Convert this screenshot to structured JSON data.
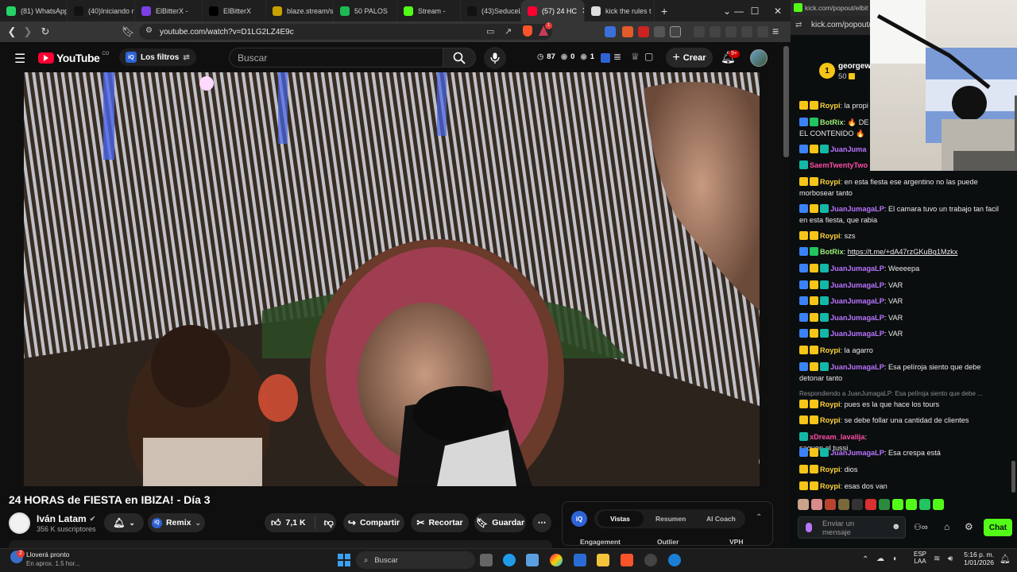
{
  "browser": {
    "tabs": [
      {
        "label": "(81) WhatsApp",
        "color": "#25d366"
      },
      {
        "label": "(40)Iniciando r",
        "color": "#111111"
      },
      {
        "label": "ElBitterX -",
        "color": "#7b3fe4"
      },
      {
        "label": "ElBitterX",
        "color": "#000000"
      },
      {
        "label": "blaze.stream/s",
        "color": "#c8a000"
      },
      {
        "label": "50 PALOS",
        "color": "#1db954"
      },
      {
        "label": "Stream -",
        "color": "#53fc18"
      },
      {
        "label": "(43)SeduceLaV",
        "color": "#111111"
      },
      {
        "label": "(57) 24 HC",
        "color": "#ff0033",
        "active": true
      },
      {
        "label": "kick the rules t",
        "color": "#dddddd"
      }
    ],
    "new_tab": "+",
    "url": "youtube.com/watch?v=D1LG2LZ4E9c",
    "shield_count": "1"
  },
  "youtube": {
    "logo_text": "YouTube",
    "logo_country": "CO",
    "filters_label": "Los filtros",
    "search_placeholder": "Buscar",
    "stats": {
      "a": "87",
      "b": "0",
      "c": "1"
    },
    "create_label": "Crear",
    "notif_count": "9+"
  },
  "video": {
    "title": "24 HORAS de FIESTA en IBIZA! - Día 3",
    "channel": "Iván Latam",
    "subscribers": "356 K suscriptores",
    "remix_label": "Remix",
    "like_count": "7,1 K",
    "share_label": "Compartir",
    "clip_label": "Recortar",
    "save_label": "Guardar",
    "more_label": "⋯"
  },
  "iq_panel": {
    "tabs": [
      "Vistas",
      "Resumen",
      "AI Coach"
    ],
    "columns": [
      "Engagement",
      "Outlier",
      "VPH"
    ]
  },
  "kick": {
    "url": "kick.com/popout/elbitt",
    "url_short": "kick.com/popout/",
    "gift_user": "georgew",
    "gift_rank": "1",
    "gift_amount": "50",
    "messages": [
      {
        "user": "Roypi",
        "text": ": la propi",
        "kind": "roy"
      },
      {
        "user": "BotRix",
        "text": ": 🔥 DE",
        "cont": "EL CONTENIDO 🔥",
        "kind": "bot"
      },
      {
        "user": "JuanJuma",
        "text": "",
        "kind": "juan"
      },
      {
        "user": "SaemTwentyTwo",
        "text": "",
        "kind": "red"
      },
      {
        "user": "Roypi",
        "text": ": en esta fiesta ese argentino no las puede",
        "cont": "morbosear tanto",
        "kind": "roy"
      },
      {
        "user": "JuanJumagaLP",
        "text": ": El camara tuvo un trabajo tan facil",
        "cont": "en esta fiesta, que rabia",
        "kind": "juan"
      },
      {
        "user": "Roypi",
        "text": ": szs",
        "kind": "roy"
      },
      {
        "user": "BotRix",
        "text": ": ",
        "link": "https://t.me/+dA47rzGKuBg1Mzkx",
        "kind": "bot"
      },
      {
        "user": "JuanJumagaLP",
        "text": ": Weeeepa",
        "kind": "juan"
      },
      {
        "user": "JuanJumagaLP",
        "text": ": VAR",
        "kind": "juan"
      },
      {
        "user": "JuanJumagaLP",
        "text": ": VAR",
        "kind": "juan"
      },
      {
        "user": "JuanJumagaLP",
        "text": ": VAR",
        "kind": "juan"
      },
      {
        "user": "JuanJumagaLP",
        "text": ": VAR",
        "kind": "juan"
      },
      {
        "user": "Roypi",
        "text": ": la agarro",
        "kind": "roy"
      },
      {
        "user": "JuanJumagaLP",
        "text": ": Esa pelíroja siento que debe",
        "cont": "detonar tanto",
        "kind": "juan"
      },
      {
        "reply": "Respondiendo a JuanJumagaLP: Esa pelíroja siento que debe ..."
      },
      {
        "user": "Roypi",
        "text": ": pues es la que hace los tours",
        "kind": "roy"
      },
      {
        "user": "Roypi",
        "text": ": se debe follar una cantidad de clientes",
        "kind": "roy"
      },
      {
        "user": "xDream_lavalija",
        "text": ": saquen el tussi",
        "kind": "red"
      },
      {
        "user": "JuanJumagaLP",
        "text": ": Esa crespa está",
        "kind": "juan"
      },
      {
        "user": "Roypi",
        "text": ": dios",
        "kind": "roy"
      },
      {
        "user": "Roypi",
        "text": ": esas dos van",
        "kind": "roy"
      }
    ],
    "input_placeholder": "Enviar un mensaje",
    "chat_button": "Chat"
  },
  "taskbar": {
    "weather_count": "2",
    "weather_title": "Lloverá pronto",
    "weather_sub": "En aprox. 1.5 hor...",
    "search_label": "Buscar",
    "lang_top": "ESP",
    "lang_bottom": "LAA",
    "time": "5:16 p. m.",
    "date": "1/01/2026"
  }
}
